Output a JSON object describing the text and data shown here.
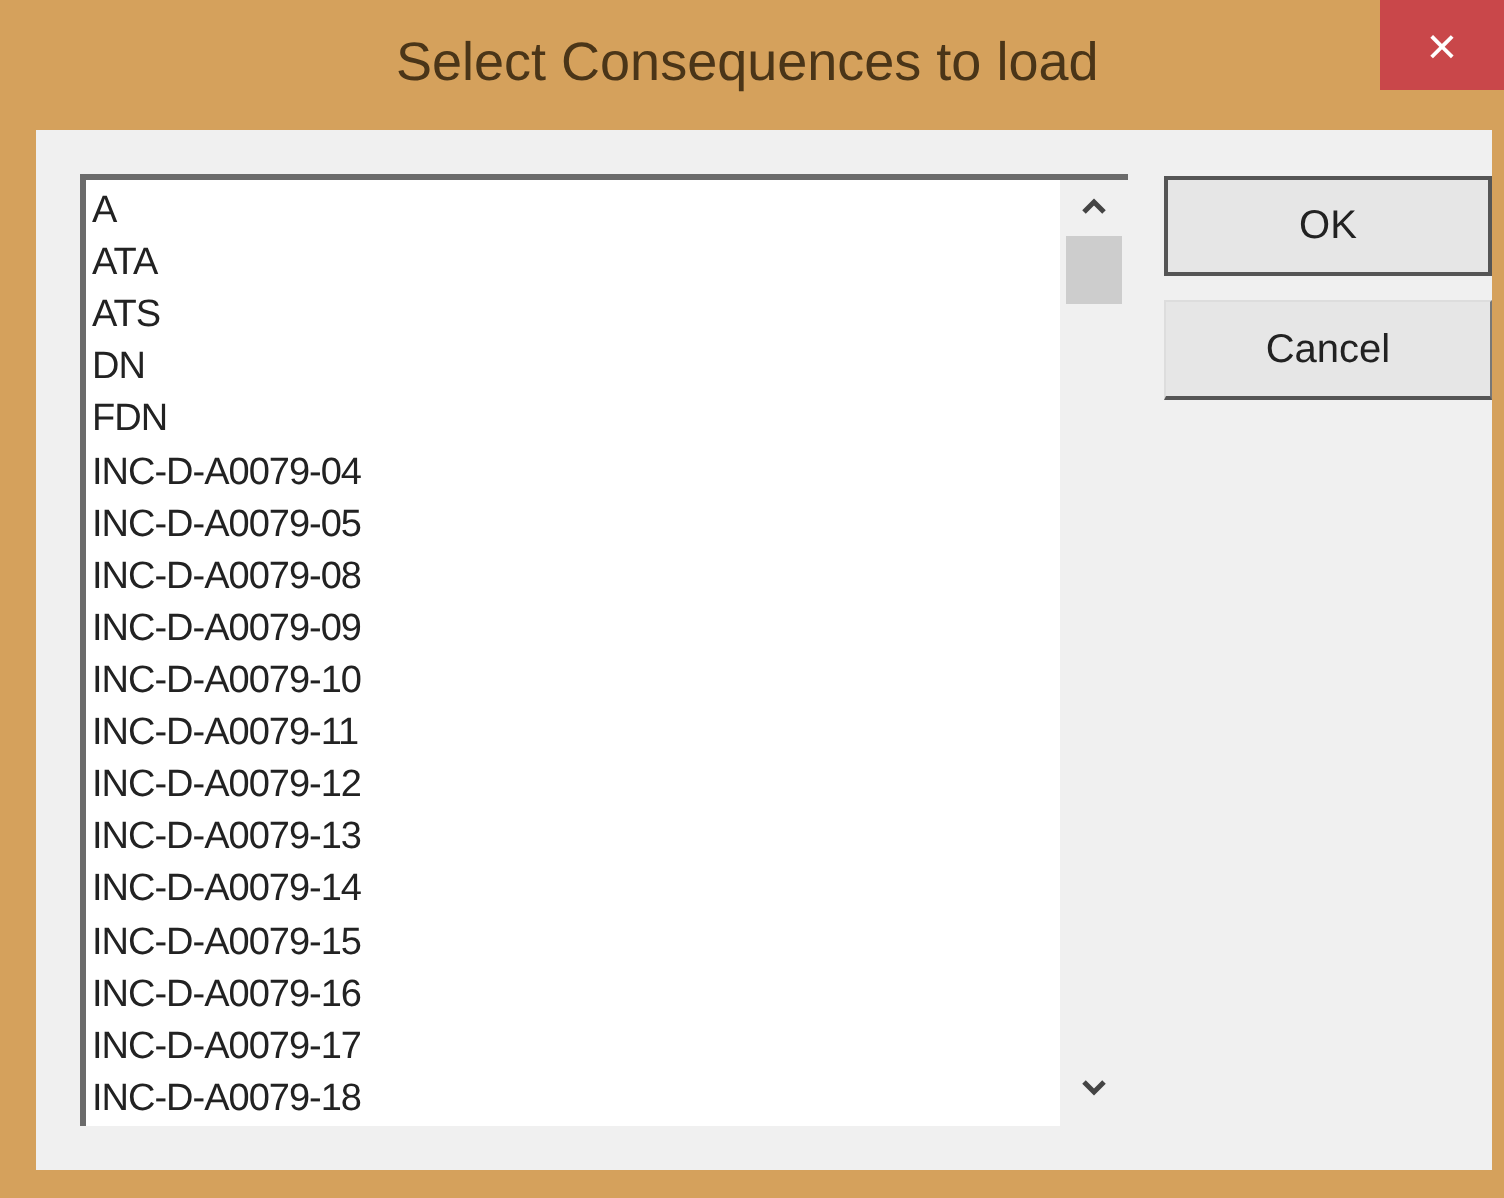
{
  "window": {
    "title": "Select Consequences to load",
    "close": "×"
  },
  "list": {
    "items": [
      {
        "label": "A",
        "selected": false
      },
      {
        "label": "ATA",
        "selected": false
      },
      {
        "label": "ATS",
        "selected": false
      },
      {
        "label": "DN",
        "selected": false
      },
      {
        "label": "FDN",
        "selected": false
      },
      {
        "label": "INC-D-A0079-04",
        "selected": false
      },
      {
        "label": "INC-D-A0079-05",
        "selected": false
      },
      {
        "label": "INC-D-A0079-08",
        "selected": false
      },
      {
        "label": "INC-D-A0079-09",
        "selected": false
      },
      {
        "label": "INC-D-A0079-10",
        "selected": false
      },
      {
        "label": "INC-D-A0079-11",
        "selected": false
      },
      {
        "label": "INC-D-A0079-12",
        "selected": false
      },
      {
        "label": "INC-D-A0079-13",
        "selected": false
      },
      {
        "label": "INC-D-A0079-14",
        "selected": false
      },
      {
        "label": "INC-D-A0079-15",
        "selected": false
      },
      {
        "label": "INC-D-A0079-16",
        "selected": false
      },
      {
        "label": "INC-D-A0079-17",
        "selected": false
      },
      {
        "label": "INC-D-A0079-18",
        "selected": false
      }
    ]
  },
  "buttons": [
    {
      "label": "OK",
      "default": true
    },
    {
      "label": "Cancel",
      "default": false
    }
  ]
}
